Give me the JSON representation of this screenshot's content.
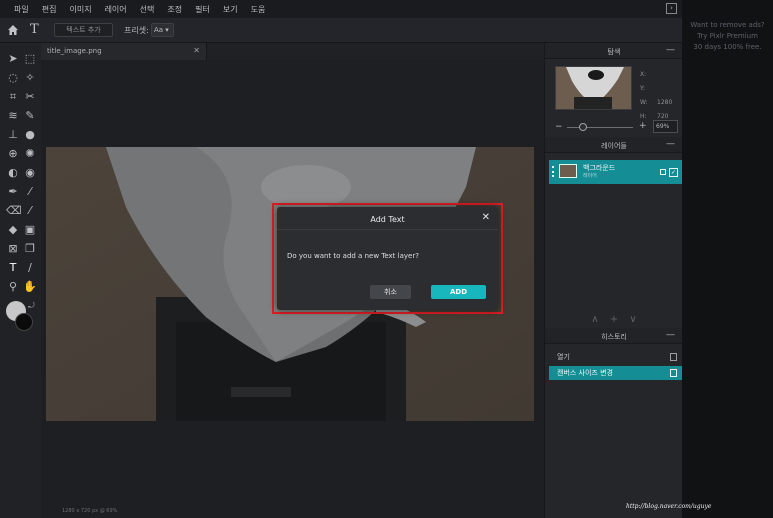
{
  "menu": [
    "파일",
    "편집",
    "이미지",
    "레이어",
    "선택",
    "조정",
    "필터",
    "보기",
    "도움"
  ],
  "options": {
    "add_text": "텍스트 추가",
    "preset_label": "프리셋:",
    "preset_value": "Aa ▾"
  },
  "document": {
    "tab_name": "title_image.png",
    "status": "1280 x 720 px @ 69%"
  },
  "dialog": {
    "title": "Add Text",
    "message": "Do you want to add a new Text layer?",
    "cancel": "취소",
    "add": "ADD",
    "close": "✕"
  },
  "navigator": {
    "title": "탐색",
    "x_label": "X:",
    "y_label": "Y:",
    "w_label": "W:",
    "w_value": "1280",
    "h_label": "H:",
    "h_value": "720",
    "zoom": "69%"
  },
  "layers": {
    "title": "레이어들",
    "items": [
      {
        "name": "백그라운드",
        "sub": "레이어"
      }
    ]
  },
  "history": {
    "title": "히스토리",
    "items": [
      "열기",
      "캔버스 사이즈 변경"
    ]
  },
  "ads": [
    "Want to remove ads?",
    "Try Pixlr Premium",
    "30 days 100% free."
  ],
  "watermark": "http://blog.naver.com/uguye",
  "colors": {
    "accent": "#17b7bd",
    "highlight_frame": "#e11d25",
    "active_row": "#148e94"
  }
}
